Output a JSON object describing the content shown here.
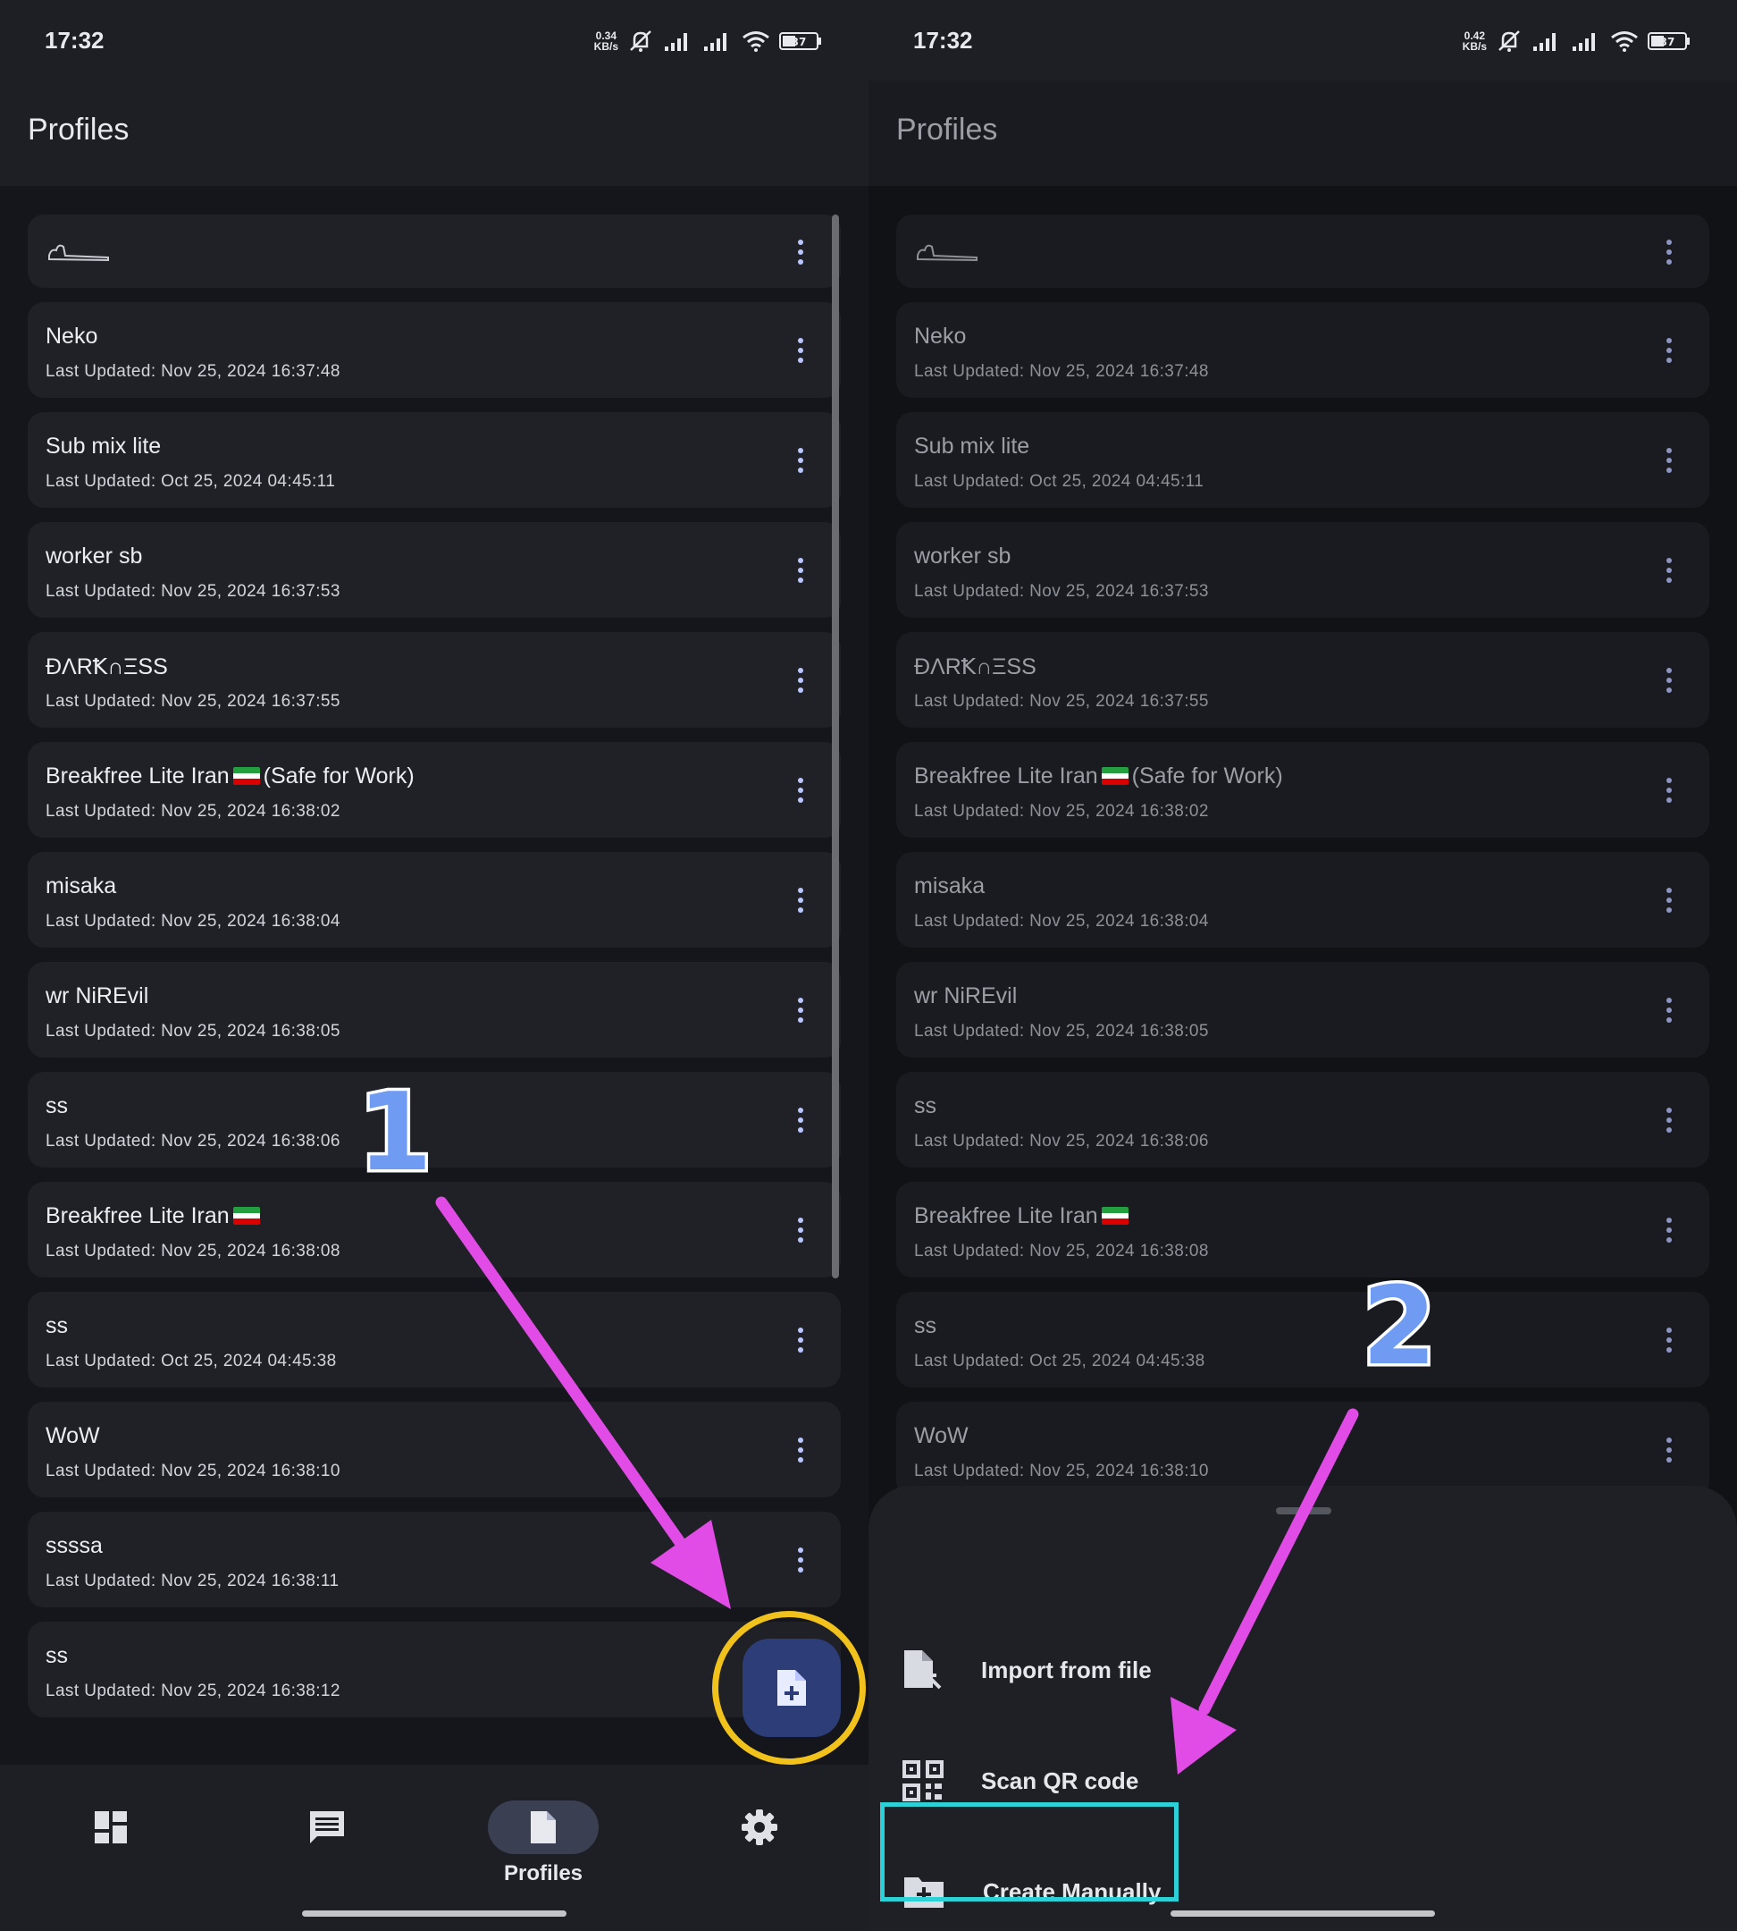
{
  "left": {
    "status": {
      "time": "17:32",
      "speed_value": "0.34",
      "speed_unit": "KB/s",
      "battery": "37"
    },
    "title": "Profiles"
  },
  "right": {
    "status": {
      "time": "17:32",
      "speed_value": "0.42",
      "speed_unit": "KB/s",
      "battery": "37"
    },
    "title": "Profiles"
  },
  "profiles": [
    {
      "name": "Neko",
      "updated": "Last Updated: Nov 25, 2024 16:37:48"
    },
    {
      "name": "Sub mix lite",
      "updated": "Last Updated: Oct 25, 2024 04:45:11"
    },
    {
      "name": "worker sb",
      "updated": "Last Updated: Nov 25, 2024 16:37:53"
    },
    {
      "name": "ĐΛRꝀ∩ΞSS",
      "updated": "Last Updated: Nov 25, 2024 16:37:55"
    },
    {
      "name_prefix": "Breakfree Lite Iran",
      "name_suffix": "(Safe for Work)",
      "updated": "Last Updated: Nov 25, 2024 16:38:02"
    },
    {
      "name": "misaka",
      "updated": "Last Updated: Nov 25, 2024 16:38:04"
    },
    {
      "name": "wr NiREvil",
      "updated": "Last Updated: Nov 25, 2024 16:38:05"
    },
    {
      "name": "ss",
      "updated": "Last Updated: Nov 25, 2024 16:38:06"
    },
    {
      "name_prefix": "Breakfree Lite Iran",
      "updated": "Last Updated: Nov 25, 2024 16:38:08"
    },
    {
      "name": "ss",
      "updated": "Last Updated: Oct 25, 2024 04:45:38"
    },
    {
      "name": "WoW",
      "updated": "Last Updated: Nov 25, 2024 16:38:10"
    },
    {
      "name": "ssssa",
      "updated": "Last Updated: Nov 25, 2024 16:38:11"
    },
    {
      "name": "ss",
      "updated": "Last Updated: Nov 25, 2024 16:38:12"
    }
  ],
  "nav": {
    "items": [
      "dashboard-icon",
      "logs-icon",
      "profiles-icon",
      "settings-icon"
    ],
    "active_label": "Profiles"
  },
  "sheet": {
    "import_from_file": "Import from file",
    "scan_qr_code": "Scan QR code",
    "create_manually": "Create Manually"
  },
  "annotations": {
    "step1": "1",
    "step2": "2"
  },
  "colors": {
    "accent_fab": "#2c3d78",
    "fab_ring": "#f1c21b",
    "arrow": "#e24ce6",
    "highlight_box": "#2bd1d6",
    "step_number": "#6f9bf2"
  }
}
